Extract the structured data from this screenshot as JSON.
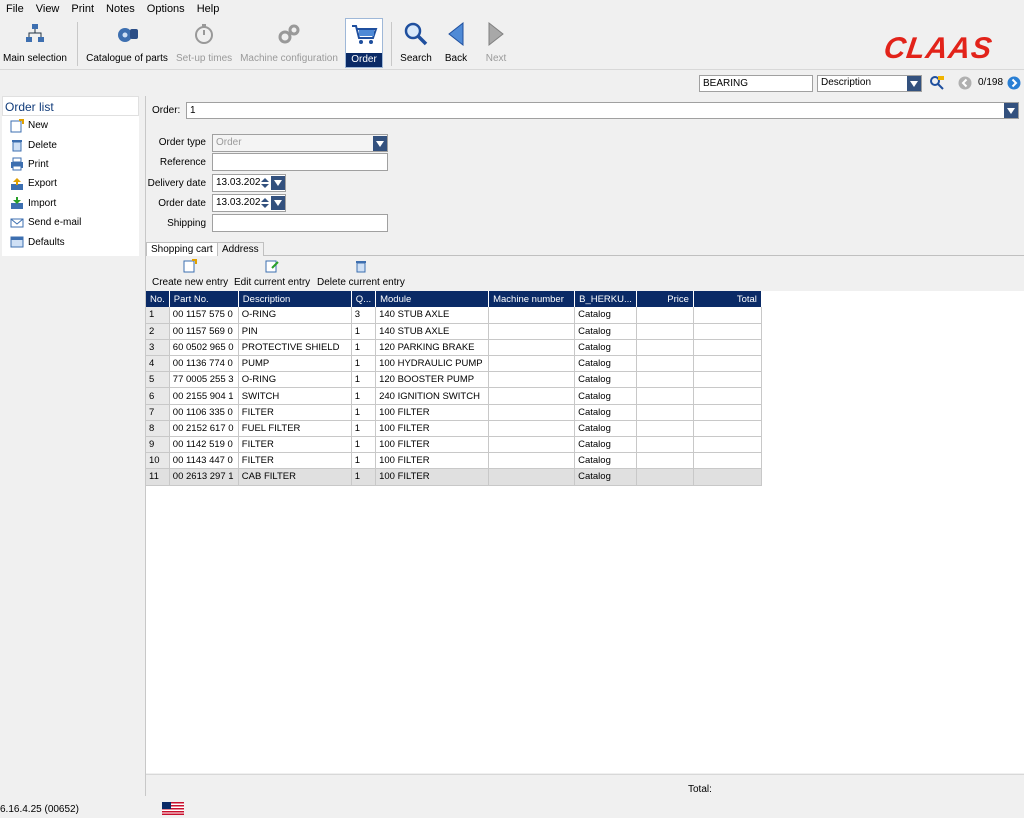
{
  "menu": [
    "File",
    "View",
    "Print",
    "Notes",
    "Options",
    "Help"
  ],
  "toolbar": {
    "main_selection": "Main selection",
    "catalogue": "Catalogue of parts",
    "setup_times": "Set-up times",
    "machine_config": "Machine configuration",
    "order": "Order",
    "search": "Search",
    "back": "Back",
    "next": "Next",
    "brand": "CLAAS"
  },
  "search": {
    "query": "BEARING",
    "field": "Description",
    "hits": "0/198"
  },
  "order_list": {
    "title": "Order list",
    "items": [
      "New",
      "Delete",
      "Print",
      "Export",
      "Import",
      "Send e-mail",
      "Defaults"
    ]
  },
  "form": {
    "order_label": "Order:",
    "order_value": "1",
    "order_type_label": "Order type",
    "order_type_value": "Order",
    "reference_label": "Reference",
    "reference_value": "",
    "delivery_date_label": "Delivery date",
    "delivery_date_value": "13.03.202",
    "order_date_label": "Order date",
    "order_date_value": "13.03.202",
    "shipping_label": "Shipping",
    "shipping_value": ""
  },
  "tabs": [
    "Shopping cart",
    "Address"
  ],
  "actions": {
    "create": "Create new entry",
    "edit": "Edit current entry",
    "delete": "Delete current entry"
  },
  "table": {
    "headers": [
      "No.",
      "Part No.",
      "Description",
      "Q...",
      "Module",
      "Machine number",
      "B_HERKU...",
      "Price",
      "Total"
    ],
    "rows": [
      [
        "1",
        "00 1157 575 0",
        "O-RING",
        "3",
        "140 STUB AXLE",
        "",
        "Catalog",
        "",
        ""
      ],
      [
        "2",
        "00 1157 569 0",
        "PIN",
        "1",
        "140 STUB AXLE",
        "",
        "Catalog",
        "",
        ""
      ],
      [
        "3",
        "60 0502 965 0",
        "PROTECTIVE SHIELD",
        "1",
        "120 PARKING BRAKE",
        "",
        "Catalog",
        "",
        ""
      ],
      [
        "4",
        "00 1136 774 0",
        "PUMP",
        "1",
        "100 HYDRAULIC PUMP",
        "",
        "Catalog",
        "",
        ""
      ],
      [
        "5",
        "77 0005 255 3",
        "O-RING",
        "1",
        "120 BOOSTER PUMP",
        "",
        "Catalog",
        "",
        ""
      ],
      [
        "6",
        "00 2155 904 1",
        "SWITCH",
        "1",
        "240 IGNITION SWITCH",
        "",
        "Catalog",
        "",
        ""
      ],
      [
        "7",
        "00 1106 335 0",
        "FILTER",
        "1",
        "100 FILTER",
        "",
        "Catalog",
        "",
        ""
      ],
      [
        "8",
        "00 2152 617 0",
        "FUEL FILTER",
        "1",
        "100 FILTER",
        "",
        "Catalog",
        "",
        ""
      ],
      [
        "9",
        "00 1142 519 0",
        "FILTER",
        "1",
        "100 FILTER",
        "",
        "Catalog",
        "",
        ""
      ],
      [
        "10",
        "00 1143 447 0",
        "FILTER",
        "1",
        "100 FILTER",
        "",
        "Catalog",
        "",
        ""
      ],
      [
        "11",
        "00 2613 297 1",
        "CAB FILTER",
        "1",
        "100 FILTER",
        "",
        "Catalog",
        "",
        ""
      ]
    ]
  },
  "total_label": "Total:",
  "status": {
    "version": "6.16.4.25 (00652)"
  },
  "colors": {
    "header_navy": "#0a2a66",
    "brand_red": "#e2231a"
  }
}
